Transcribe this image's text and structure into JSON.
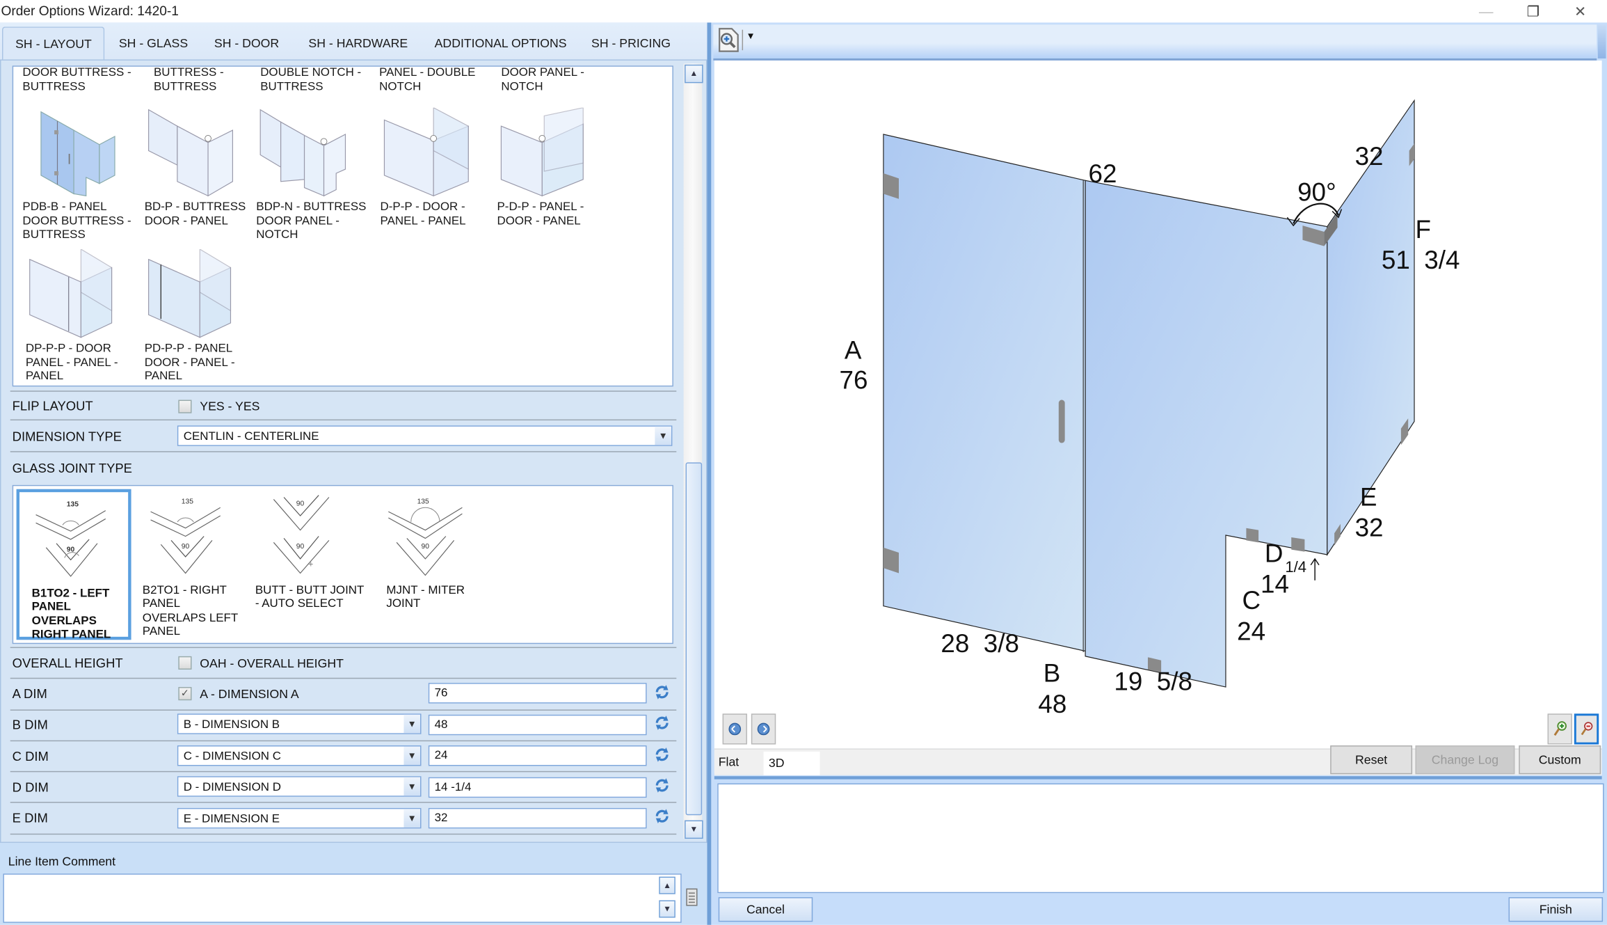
{
  "window": {
    "title": "Order Options Wizard: 1420-1",
    "controls": {
      "minimize": "—",
      "restore": "❐",
      "close": "✕"
    }
  },
  "tabs": [
    {
      "label": "SH - LAYOUT",
      "active": true
    },
    {
      "label": "SH - GLASS",
      "active": false
    },
    {
      "label": "SH - DOOR",
      "active": false
    },
    {
      "label": "SH - HARDWARE",
      "active": false
    },
    {
      "label": "ADDITIONAL OPTIONS",
      "active": false
    },
    {
      "label": "SH - PRICING",
      "active": false
    }
  ],
  "layout_gallery": {
    "partial_row": [
      {
        "label": "DOOR BUTTRESS - BUTTRESS"
      },
      {
        "label": "BUTTRESS - BUTTRESS"
      },
      {
        "label": "DOUBLE NOTCH - BUTTRESS"
      },
      {
        "label": "PANEL - DOUBLE NOTCH"
      },
      {
        "label": "DOOR PANEL - NOTCH"
      }
    ],
    "items": [
      {
        "label": "PDB-B - PANEL DOOR BUTTRESS - BUTTRESS",
        "icon": "layout-pdb-b-thumbnail"
      },
      {
        "label": "BD-P - BUTTRESS DOOR - PANEL",
        "icon": "layout-bd-p-thumbnail"
      },
      {
        "label": "BDP-N - BUTTRESS DOOR PANEL - NOTCH",
        "icon": "layout-bdp-n-thumbnail"
      },
      {
        "label": "D-P-P - DOOR - PANEL - PANEL",
        "icon": "layout-d-p-p-thumbnail"
      },
      {
        "label": "P-D-P - PANEL - DOOR - PANEL",
        "icon": "layout-p-d-p-thumbnail"
      },
      {
        "label": "DP-P-P - DOOR PANEL - PANEL - PANEL",
        "icon": "layout-dp-p-p-thumbnail"
      },
      {
        "label": "PD-P-P - PANEL DOOR - PANEL - PANEL",
        "icon": "layout-pd-p-p-thumbnail"
      }
    ]
  },
  "flip_layout": {
    "label": "FLIP LAYOUT",
    "option": "YES - YES",
    "checked": false
  },
  "dimension_type": {
    "label": "DIMENSION TYPE",
    "value": "CENTLIN - CENTERLINE"
  },
  "glass_joint_type": {
    "label": "GLASS JOINT TYPE",
    "options": [
      {
        "label": "B1TO2 - LEFT PANEL OVERLAPS RIGHT PANEL",
        "angle_top": "135",
        "angle_bottom": "90",
        "selected": true
      },
      {
        "label": "B2TO1 - RIGHT PANEL OVERLAPS LEFT PANEL",
        "angle_top": "135",
        "angle_bottom": "90",
        "selected": false
      },
      {
        "label": "BUTT - BUTT JOINT - AUTO SELECT",
        "angle_top": "90",
        "angle_bottom": "90",
        "selected": false
      },
      {
        "label": "MJNT - MITER JOINT",
        "angle_top": "135",
        "angle_bottom": "90",
        "selected": false
      }
    ]
  },
  "overall_height": {
    "label": "OVERALL HEIGHT",
    "option": "OAH - OVERALL HEIGHT",
    "checked": false
  },
  "dims": [
    {
      "label": "A DIM",
      "kind": "checkbox",
      "option": "A - DIMENSION A",
      "checked": true,
      "value": "76"
    },
    {
      "label": "B DIM",
      "kind": "select",
      "option": "B - DIMENSION B",
      "value": "48"
    },
    {
      "label": "C DIM",
      "kind": "select",
      "option": "C - DIMENSION C",
      "value": "24"
    },
    {
      "label": "D DIM",
      "kind": "select",
      "option": "D - DIMENSION D",
      "value": "14 -1/4"
    },
    {
      "label": "E DIM",
      "kind": "select",
      "option": "E - DIMENSION E",
      "value": "32"
    }
  ],
  "comment": {
    "label": "Line Item Comment",
    "value": ""
  },
  "viewer": {
    "toolbar_icon": "zoom-document-icon",
    "drawing_labels": {
      "top_left_width": "62",
      "top_return": "32",
      "angle": "90°",
      "f_letter": "F",
      "f_value": "51  3/4",
      "a_letter": "A",
      "a_value": "76",
      "b_left": "28  3/8",
      "b_letter": "B",
      "b_value": "48",
      "b_right": "19  5/8",
      "c_letter": "C",
      "c_value": "24",
      "d_letter": "D",
      "d_value": "14",
      "d_fraction": "1/4",
      "e_letter": "E",
      "e_value": "32"
    },
    "view_tabs": [
      {
        "label": "Flat",
        "active": false
      },
      {
        "label": "3D",
        "active": true
      }
    ],
    "buttons": {
      "reset": "Reset",
      "change_log": "Change Log",
      "custom": "Custom"
    }
  },
  "footer": {
    "cancel": "Cancel",
    "finish": "Finish"
  },
  "colors": {
    "accent": "#5ba0e0",
    "glass": "#b6cff2",
    "pane_bg": "#c6ddfa"
  }
}
